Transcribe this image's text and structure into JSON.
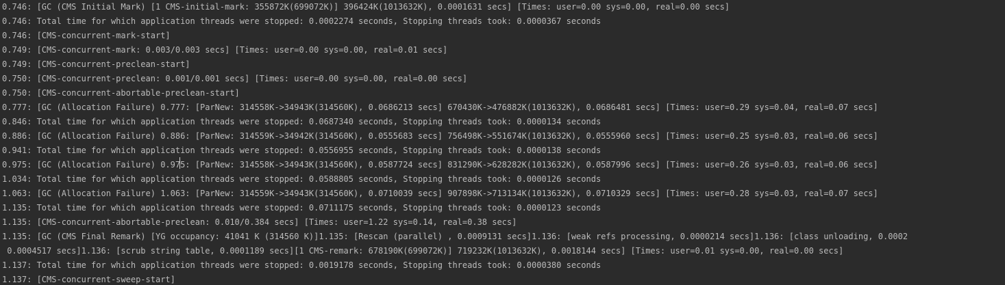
{
  "console": {
    "lines": [
      "0.746: [GC (CMS Initial Mark) [1 CMS-initial-mark: 355872K(699072K)] 396424K(1013632K), 0.0001631 secs] [Times: user=0.00 sys=0.00, real=0.00 secs]",
      "0.746: Total time for which application threads were stopped: 0.0002274 seconds, Stopping threads took: 0.0000367 seconds",
      "0.746: [CMS-concurrent-mark-start]",
      "0.749: [CMS-concurrent-mark: 0.003/0.003 secs] [Times: user=0.00 sys=0.00, real=0.01 secs]",
      "0.749: [CMS-concurrent-preclean-start]",
      "0.750: [CMS-concurrent-preclean: 0.001/0.001 secs] [Times: user=0.00 sys=0.00, real=0.00 secs]",
      "0.750: [CMS-concurrent-abortable-preclean-start]",
      "0.777: [GC (Allocation Failure) 0.777: [ParNew: 314558K->34943K(314560K), 0.0686213 secs] 670430K->476882K(1013632K), 0.0686481 secs] [Times: user=0.29 sys=0.04, real=0.07 secs]",
      "0.846: Total time for which application threads were stopped: 0.0687340 seconds, Stopping threads took: 0.0000134 seconds",
      "0.886: [GC (Allocation Failure) 0.886: [ParNew: 314559K->34942K(314560K), 0.0555683 secs] 756498K->551674K(1013632K), 0.0555960 secs] [Times: user=0.25 sys=0.03, real=0.06 secs]",
      "0.941: Total time for which application threads were stopped: 0.0556955 seconds, Stopping threads took: 0.0000138 seconds",
      "0.975: [GC (Allocation Failure) 0.975: [ParNew: 314558K->34943K(314560K), 0.0587724 secs] 831290K->628282K(1013632K), 0.0587996 secs] [Times: user=0.26 sys=0.03, real=0.06 secs]",
      "1.034: Total time for which application threads were stopped: 0.0588805 seconds, Stopping threads took: 0.0000126 seconds",
      "1.063: [GC (Allocation Failure) 1.063: [ParNew: 314559K->34943K(314560K), 0.0710039 secs] 907898K->713134K(1013632K), 0.0710329 secs] [Times: user=0.28 sys=0.03, real=0.07 secs]",
      "1.135: Total time for which application threads were stopped: 0.0711175 seconds, Stopping threads took: 0.0000123 seconds",
      "1.135: [CMS-concurrent-abortable-preclean: 0.010/0.384 secs] [Times: user=1.22 sys=0.14, real=0.38 secs]",
      "1.135: [GC (CMS Final Remark) [YG occupancy: 41041 K (314560 K)]1.135: [Rescan (parallel) , 0.0009131 secs]1.136: [weak refs processing, 0.0000214 secs]1.136: [class unloading, 0.0002",
      " 0.0004517 secs]1.136: [scrub string table, 0.0001189 secs][1 CMS-remark: 678190K(699072K)] 719232K(1013632K), 0.0018144 secs] [Times: user=0.01 sys=0.00, real=0.00 secs]",
      "1.137: Total time for which application threads were stopped: 0.0019178 seconds, Stopping threads took: 0.0000380 seconds",
      "1.137: [CMS-concurrent-sweep-start]"
    ]
  }
}
